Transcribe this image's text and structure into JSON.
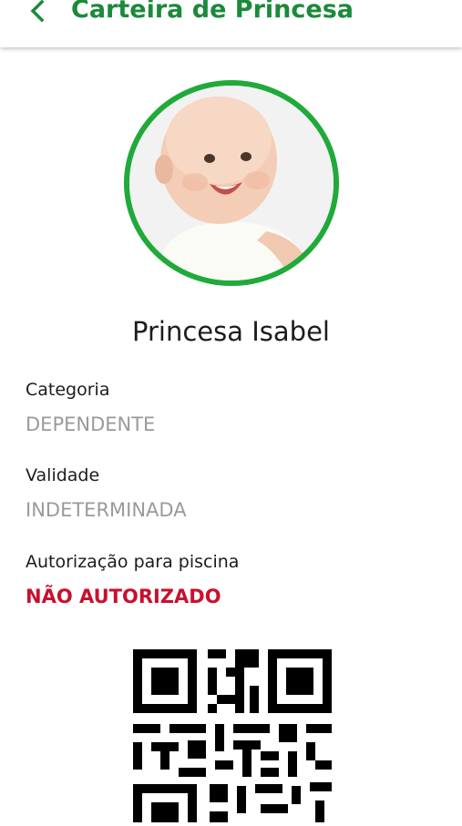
{
  "header": {
    "title": "Carteira de Princesa",
    "back_icon": "chevron-left-icon",
    "accent": "#1b8a3a"
  },
  "profile": {
    "name": "Princesa Isabel",
    "ring_color": "#1faa3a"
  },
  "fields": [
    {
      "label": "Categoria",
      "value": "DEPENDENTE"
    },
    {
      "label": "Validade",
      "value": "INDETERMINADA"
    },
    {
      "label": "Autorização para piscina",
      "value": "NÃO AUTORIZADO",
      "value_color": "#c8102e"
    }
  ]
}
